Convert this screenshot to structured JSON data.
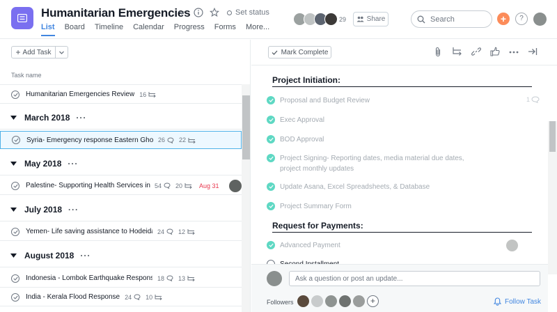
{
  "project": {
    "title": "Humanitarian Emergencies",
    "set_status": "Set status",
    "tabs": [
      "List",
      "Board",
      "Timeline",
      "Calendar",
      "Progress",
      "Forms",
      "More..."
    ],
    "active_tab": "List",
    "member_count": "29",
    "share_label": "Share",
    "project_color": "#7a6ff0"
  },
  "topbar": {
    "search_placeholder": "Search",
    "plus_label": "+",
    "help_label": "?"
  },
  "list": {
    "add_task_label": "Add Task",
    "column_header": "Task name",
    "rows": [
      {
        "type": "task",
        "name": "Humanitarian Emergencies Review",
        "subtasks": "16"
      },
      {
        "type": "section",
        "name": "March 2018"
      },
      {
        "type": "task",
        "name": "Syria- Emergency response Eastern Ghouta",
        "comments": "26",
        "subtasks": "22",
        "selected": true
      },
      {
        "type": "section",
        "name": "May 2018"
      },
      {
        "type": "task",
        "name": "Palestine- Supporting Health Services in Gaza",
        "comments": "54",
        "subtasks": "20",
        "due": "Aug 31",
        "avatar": true
      },
      {
        "type": "section",
        "name": "July 2018"
      },
      {
        "type": "task",
        "name": "Yemen- Life saving assistance to Hodeidah",
        "comments": "24",
        "subtasks": "12"
      },
      {
        "type": "section",
        "name": "August 2018"
      },
      {
        "type": "task",
        "name": "Indonesia - Lombok Earthquake Response",
        "comments": "18",
        "subtasks": "13"
      },
      {
        "type": "task",
        "name": "India - Kerala Flood Response",
        "comments": "24",
        "subtasks": "10"
      }
    ]
  },
  "detail": {
    "mark_complete_label": "Mark Complete",
    "sections": [
      {
        "title": "Project Initiation:"
      },
      {
        "title": "Request for Payments:"
      }
    ],
    "subtasks": [
      "Proposal and Budget Review",
      "Exec Approval",
      "BOD Approval",
      "Project Signing- Reporting dates, media material due dates,",
      "project monthly updates",
      "Update Asana, Excel Spreadsheets, & Database",
      "Project Summary Form",
      "Advanced Payment",
      "Second Installment"
    ],
    "first_subtask_comment_count": "1",
    "comment_placeholder": "Ask a question or post an update...",
    "followers_label": "Followers",
    "follow_label": "Follow Task"
  },
  "colors": {
    "accent": "#4186e0",
    "complete_green": "#5ed8c3",
    "due_red": "#e8384f",
    "plus_orange": "#fc8c5a"
  }
}
